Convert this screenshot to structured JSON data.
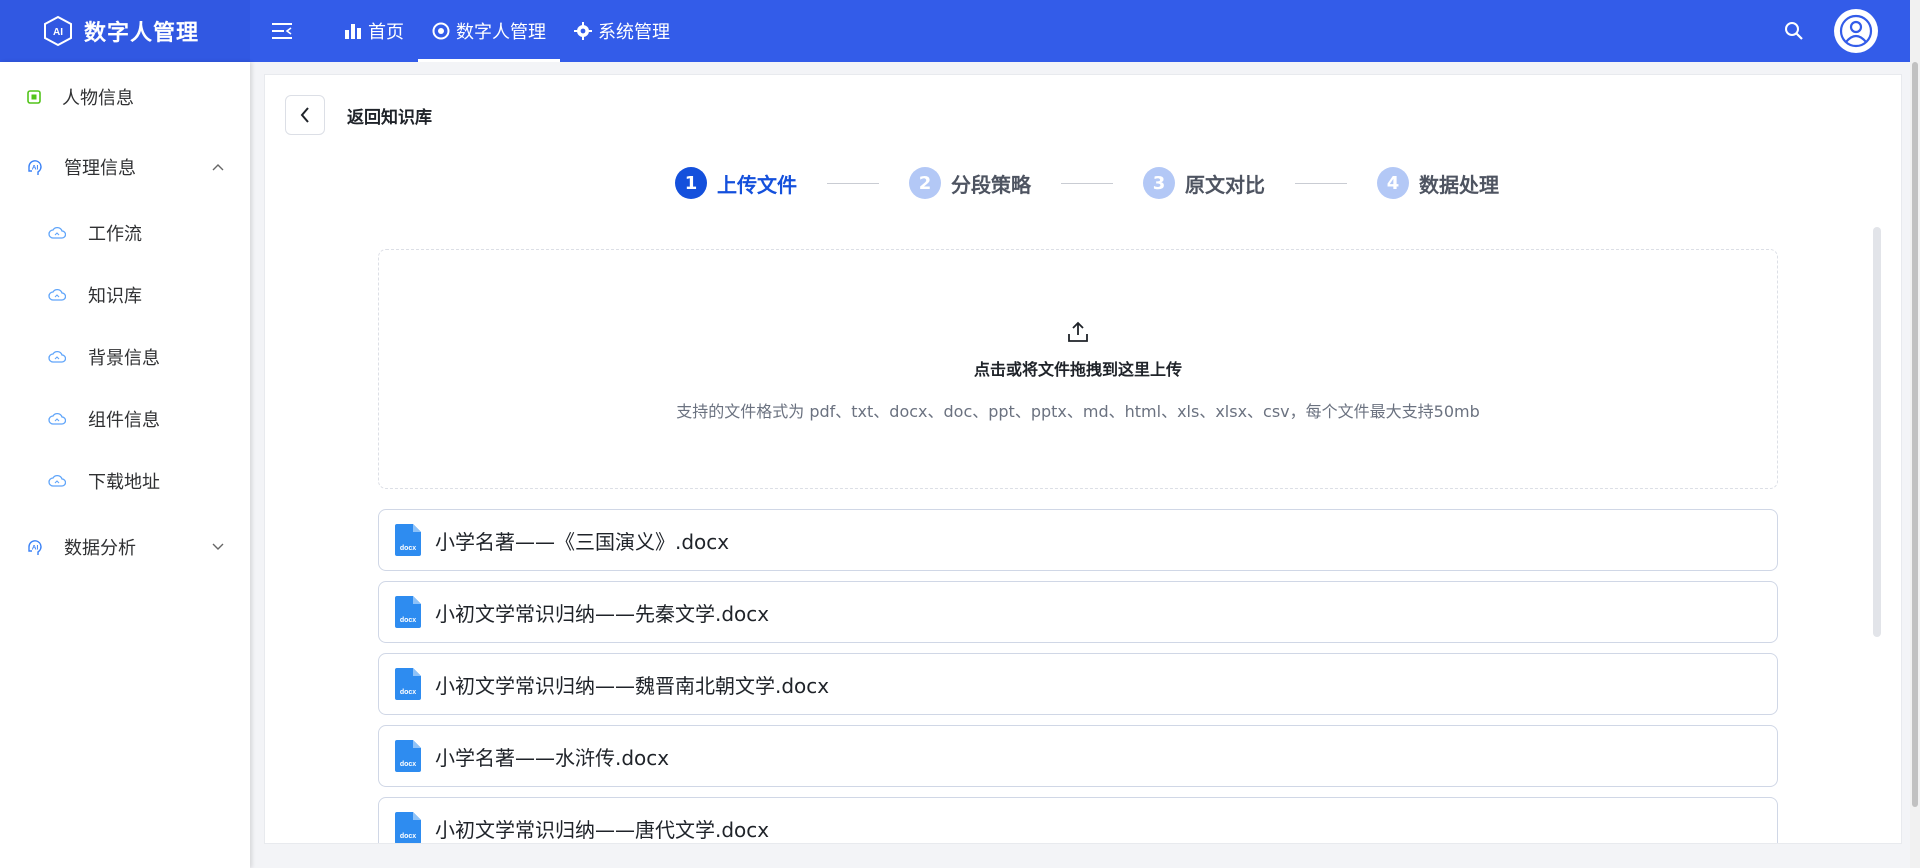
{
  "brand": {
    "title": "数字人管理",
    "logo": "ai-hexagon-logo"
  },
  "topnav": {
    "items": [
      {
        "label": "首页",
        "icon": "bar-chart-icon",
        "active": false
      },
      {
        "label": "数字人管理",
        "icon": "aperture-icon",
        "active": true
      },
      {
        "label": "系统管理",
        "icon": "gear-icon",
        "active": false
      }
    ]
  },
  "sidebar": {
    "items": [
      {
        "label": "人物信息",
        "icon": "chip-icon"
      },
      {
        "label": "管理信息",
        "icon": "ai-brain-icon",
        "expanded": true
      },
      {
        "label": "工作流",
        "icon": "cloud-icon"
      },
      {
        "label": "知识库",
        "icon": "cloud-icon"
      },
      {
        "label": "背景信息",
        "icon": "cloud-icon"
      },
      {
        "label": "组件信息",
        "icon": "cloud-icon"
      },
      {
        "label": "下载地址",
        "icon": "cloud-icon"
      },
      {
        "label": "数据分析",
        "icon": "ai-brain-icon",
        "expanded": false
      }
    ]
  },
  "main": {
    "back_label": "返回知识库",
    "steps": [
      {
        "num": "1",
        "label": "上传文件",
        "active": true
      },
      {
        "num": "2",
        "label": "分段策略",
        "active": false
      },
      {
        "num": "3",
        "label": "原文对比",
        "active": false
      },
      {
        "num": "4",
        "label": "数据处理",
        "active": false
      }
    ],
    "upload": {
      "title": "点击或将文件拖拽到这里上传",
      "hint": "支持的文件格式为 pdf、txt、docx、doc、ppt、pptx、md、html、xls、xlsx、csv，每个文件最大支持50mb"
    },
    "files": [
      {
        "name": "小学名著——《三国演义》.docx",
        "badge": "docx"
      },
      {
        "name": "小初文学常识归纳——先秦文学.docx",
        "badge": "docx"
      },
      {
        "name": "小初文学常识归纳——魏晋南北朝文学.docx",
        "badge": "docx"
      },
      {
        "name": "小学名著——水浒传.docx",
        "badge": "docx"
      },
      {
        "name": "小初文学常识归纳——唐代文学.docx",
        "badge": "docx"
      }
    ]
  },
  "colors": {
    "primary": "#335ce9",
    "step_active": "#1450dc",
    "step_inactive": "#b3c8f6",
    "file_icon": "#2e8cf0"
  }
}
